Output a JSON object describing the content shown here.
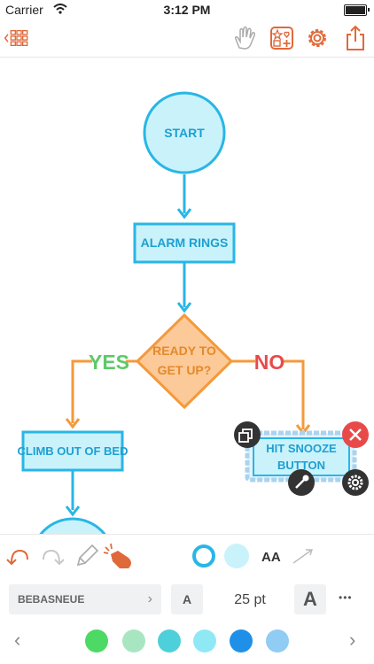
{
  "status_bar": {
    "carrier": "Carrier",
    "time": "3:12 PM"
  },
  "toolbar": {
    "icons": [
      "back-grid-icon",
      "hand-icon",
      "shapes-icon",
      "gear-icon",
      "share-icon"
    ]
  },
  "flowchart": {
    "start": "START",
    "alarm": "ALARM RINGS",
    "decision_line1": "READY TO",
    "decision_line2": "GET UP?",
    "yes": "YES",
    "no": "NO",
    "climb": "CLIMB OUT OF BED",
    "snooze_line1": "HIT SNOOZE",
    "snooze_line2": "BUTTON"
  },
  "tools": {
    "icons": [
      "undo-icon",
      "redo-icon",
      "pencil-icon",
      "magic-hand-icon",
      "stroke-color-icon",
      "fill-color-icon",
      "text-style-icon",
      "arrow-style-icon"
    ],
    "text_style_label": "AA"
  },
  "font": {
    "family": "BEBASNEUE",
    "decrease_label": "A",
    "size": "25 pt",
    "increase_label": "A",
    "more_label": "•••"
  },
  "palette": {
    "prev": "‹",
    "next": "›",
    "colors": [
      "#4cd964",
      "#a8e6c2",
      "#4dd0d9",
      "#8fe9f5",
      "#1e90e8",
      "#90ccf4"
    ]
  },
  "colors": {
    "accent_orange": "#e0693a",
    "node_blue": "#29b6e6",
    "node_fill": "#c9f2fb",
    "decision_orange": "#f39a3c",
    "decision_fill": "#fcc999",
    "yes_green": "#5ec969",
    "no_red": "#e84a4a"
  }
}
